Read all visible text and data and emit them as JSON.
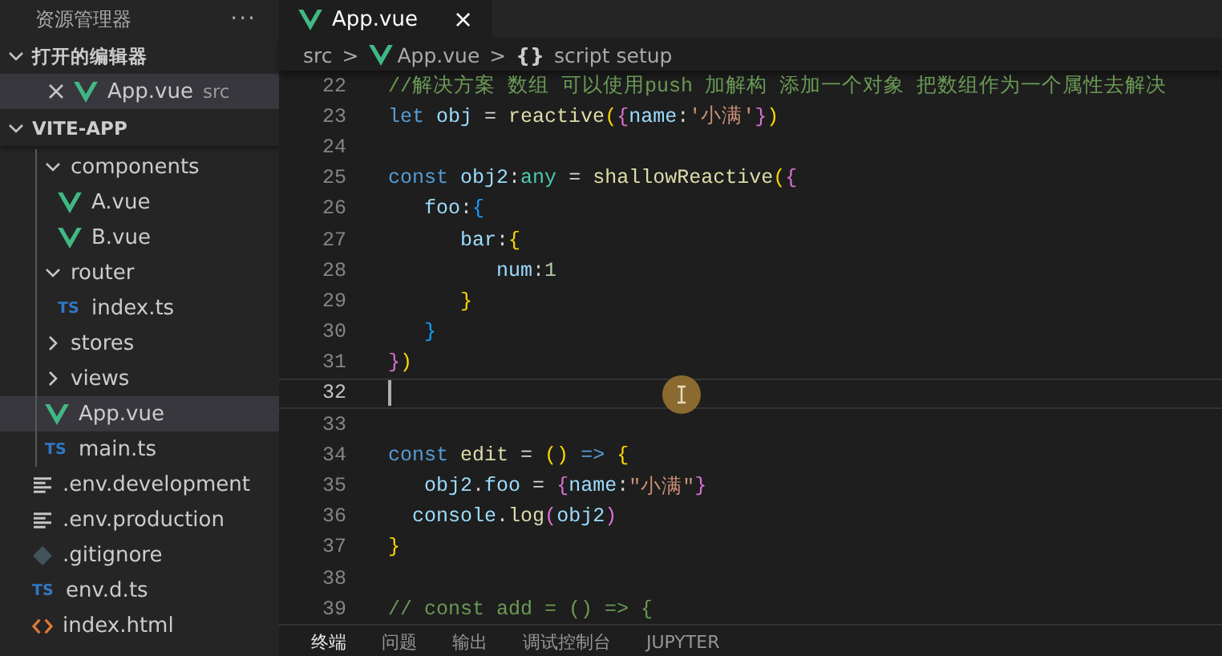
{
  "sidebar": {
    "title": "资源管理器",
    "more": "···",
    "open_editors": {
      "title": "打开的编辑器",
      "expanded": true,
      "items": [
        {
          "name": "App.vue",
          "path": "src",
          "kind": "vue",
          "selected": true
        }
      ]
    },
    "project": {
      "title": "VITE-APP",
      "expanded": true,
      "nested_items": [
        {
          "name": "components",
          "kind": "folder",
          "expanded": true,
          "selected": false,
          "children": [
            {
              "name": "A.vue",
              "kind": "vue",
              "selected": false
            },
            {
              "name": "B.vue",
              "kind": "vue",
              "selected": false
            }
          ]
        },
        {
          "name": "router",
          "kind": "folder",
          "expanded": true,
          "selected": false,
          "children": [
            {
              "name": "index.ts",
              "kind": "ts",
              "badge": "TS",
              "selected": false
            }
          ]
        },
        {
          "name": "stores",
          "kind": "folder",
          "expanded": false,
          "selected": false
        },
        {
          "name": "views",
          "kind": "folder",
          "expanded": false,
          "selected": false
        },
        {
          "name": "App.vue",
          "kind": "vue",
          "selected": true
        },
        {
          "name": "main.ts",
          "kind": "ts",
          "badge": "TS",
          "selected": false
        }
      ],
      "root_items": [
        {
          "name": ".env.development",
          "kind": "env",
          "selected": false
        },
        {
          "name": ".env.production",
          "kind": "env",
          "selected": false
        },
        {
          "name": ".gitignore",
          "kind": "git",
          "selected": false
        },
        {
          "name": "env.d.ts",
          "kind": "ts",
          "badge": "TS",
          "selected": false
        },
        {
          "name": "index.html",
          "kind": "html",
          "selected": false
        }
      ]
    }
  },
  "tabs": [
    {
      "label": "App.vue",
      "kind": "vue",
      "close": "×",
      "selected": true
    }
  ],
  "breadcrumb": {
    "folder": "src",
    "separator": ">",
    "file": "App.vue",
    "symbol_icon": "{}",
    "symbol": "script setup"
  },
  "code": {
    "lines": [
      {
        "number": "22",
        "tokens": [
          {
            "t": "//解决方案 数组 可以使用push 加解构 添加一个对象 把数组作为一个属性去解决",
            "kind": "comment"
          }
        ]
      },
      {
        "number": "23",
        "tokens": [
          {
            "t": "let",
            "kind": "keyword"
          },
          {
            "t": " obj",
            "kind": "variable"
          },
          {
            "t": " = ",
            "kind": "plain"
          },
          {
            "t": "reactive",
            "kind": "function"
          },
          {
            "t": "(",
            "kind": "bracket1"
          },
          {
            "t": "{",
            "kind": "bracket2"
          },
          {
            "t": "name",
            "kind": "variable"
          },
          {
            "t": ":",
            "kind": "plain"
          },
          {
            "t": "'小满'",
            "kind": "string"
          },
          {
            "t": "}",
            "kind": "bracket2"
          },
          {
            "t": ")",
            "kind": "bracket1"
          }
        ]
      },
      {
        "number": "24"
      },
      {
        "number": "25",
        "tokens": [
          {
            "t": "const",
            "kind": "keyword"
          },
          {
            "t": " obj2",
            "kind": "variable"
          },
          {
            "t": ":",
            "kind": "plain"
          },
          {
            "t": "any",
            "kind": "type"
          },
          {
            "t": " = ",
            "kind": "plain"
          },
          {
            "t": "shallowReactive",
            "kind": "function"
          },
          {
            "t": "(",
            "kind": "bracket1"
          },
          {
            "t": "{",
            "kind": "bracket2"
          }
        ]
      },
      {
        "number": "26",
        "tokens": [
          {
            "t": "   foo",
            "kind": "variable"
          },
          {
            "t": ":",
            "kind": "plain"
          },
          {
            "t": "{",
            "kind": "bracket3"
          }
        ]
      },
      {
        "number": "27",
        "tokens": [
          {
            "t": "      bar",
            "kind": "variable"
          },
          {
            "t": ":",
            "kind": "plain"
          },
          {
            "t": "{",
            "kind": "bracket1"
          }
        ]
      },
      {
        "number": "28",
        "tokens": [
          {
            "t": "         num",
            "kind": "variable"
          },
          {
            "t": ":",
            "kind": "plain"
          },
          {
            "t": "1",
            "kind": "number"
          }
        ]
      },
      {
        "number": "29",
        "tokens": [
          {
            "t": "      }",
            "kind": "bracket1"
          }
        ]
      },
      {
        "number": "30",
        "tokens": [
          {
            "t": "   }",
            "kind": "bracket3"
          }
        ]
      },
      {
        "number": "31",
        "tokens": [
          {
            "t": "}",
            "kind": "bracket2"
          },
          {
            "t": ")",
            "kind": "bracket1"
          }
        ]
      },
      {
        "number": "32",
        "current": true
      },
      {
        "number": "33"
      },
      {
        "number": "34",
        "tokens": [
          {
            "t": "const",
            "kind": "keyword"
          },
          {
            "t": " edit",
            "kind": "function"
          },
          {
            "t": " = ",
            "kind": "plain"
          },
          {
            "t": "()",
            "kind": "bracket1"
          },
          {
            "t": " => ",
            "kind": "keyword"
          },
          {
            "t": "{",
            "kind": "bracket1"
          }
        ]
      },
      {
        "number": "35",
        "tokens": [
          {
            "t": "   obj2",
            "kind": "variable"
          },
          {
            "t": ".",
            "kind": "plain"
          },
          {
            "t": "foo",
            "kind": "variable"
          },
          {
            "t": " = ",
            "kind": "plain"
          },
          {
            "t": "{",
            "kind": "bracket2"
          },
          {
            "t": "name",
            "kind": "variable"
          },
          {
            "t": ":",
            "kind": "plain"
          },
          {
            "t": "\"小满\"",
            "kind": "string"
          },
          {
            "t": "}",
            "kind": "bracket2"
          }
        ]
      },
      {
        "number": "36",
        "tokens": [
          {
            "t": "  console",
            "kind": "variable"
          },
          {
            "t": ".",
            "kind": "plain"
          },
          {
            "t": "log",
            "kind": "function"
          },
          {
            "t": "(",
            "kind": "bracket2"
          },
          {
            "t": "obj2",
            "kind": "variable"
          },
          {
            "t": ")",
            "kind": "bracket2"
          }
        ]
      },
      {
        "number": "37",
        "tokens": [
          {
            "t": "}",
            "kind": "bracket1"
          }
        ]
      },
      {
        "number": "38"
      },
      {
        "number": "39",
        "tokens": [
          {
            "t": "// const add = () => {",
            "kind": "comment"
          }
        ]
      }
    ]
  },
  "panel": {
    "tabs": [
      {
        "label": "终端",
        "selected": true
      },
      {
        "label": "问题",
        "selected": false
      },
      {
        "label": "输出",
        "selected": false
      },
      {
        "label": "调试控制台",
        "selected": false
      },
      {
        "label": "JUPYTER",
        "selected": false
      }
    ]
  }
}
